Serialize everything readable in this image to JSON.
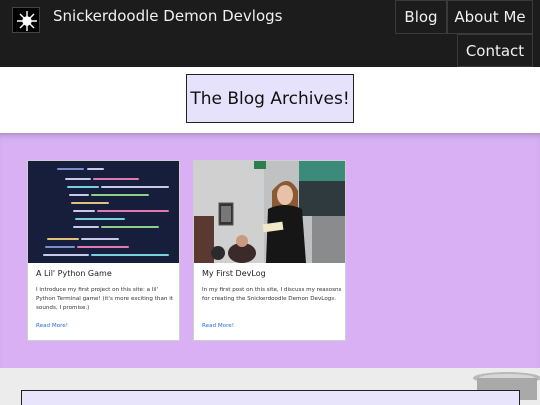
{
  "header": {
    "site_title": "Snickerdoodle Demon Devlogs",
    "logo_icon": "snowflake-logo-icon"
  },
  "nav": {
    "blog": "Blog",
    "about": "About Me",
    "contact": "Contact"
  },
  "page": {
    "heading": "The Blog Archives!"
  },
  "posts": [
    {
      "title": "A Lil' Python Game",
      "description": "I introduce my first project on this site: a lil' Python Terminal game! (it's more exciting than it sounds, I promise.)",
      "link": "Read More!"
    },
    {
      "title": "My First DevLog",
      "description": "In my first post on this site, I discuss my reasosns for creating the Snickerdoodle Demon DevLogs.",
      "link": "Read More!"
    }
  ],
  "colors": {
    "topbar": "#1c1c1c",
    "heading_box": "#e6e2fb",
    "posts_background": "#d8b0f3",
    "link": "#2a6ddb"
  }
}
